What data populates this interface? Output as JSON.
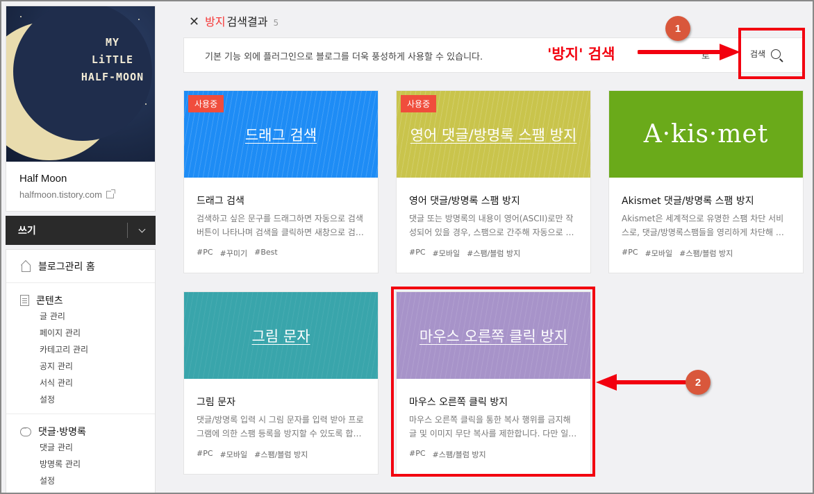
{
  "blog": {
    "cover_lines": [
      "MY",
      "LiTTLE",
      "HALF-MOON"
    ],
    "name": "Half Moon",
    "url": "halfmoon.tistory.com"
  },
  "write": {
    "label": "쓰기"
  },
  "menu": {
    "home": "블로그관리 홈",
    "sections": [
      {
        "title": "콘텐츠",
        "icon": "document-icon",
        "items": [
          "글 관리",
          "페이지 관리",
          "카테고리 관리",
          "공지 관리",
          "서식 관리",
          "설정"
        ]
      },
      {
        "title": "댓글·방명록",
        "icon": "speech-bubble-icon",
        "items": [
          "댓글 관리",
          "방명록 관리",
          "설정"
        ]
      }
    ]
  },
  "result": {
    "keyword": "방지",
    "label": "검색결과",
    "count": "5"
  },
  "search": {
    "description": "기본 기능 외에 플러그인으로 블로그를 더욱 풍성하게 사용할 수 있습니다.",
    "sort_label": "로",
    "button_label": "검색"
  },
  "plugins": [
    {
      "badge": "사용중",
      "thumb_title": "드래그 검색",
      "name": "드래그 검색",
      "desc": "검색하고 싶은 문구를 드래그하면 자동으로 검색 버튼이 나타나며 검색을 클릭하면 새창으로 검색 결과를 보여줍니다.",
      "tags": [
        "#PC",
        "#꾸미기",
        "#Best"
      ],
      "color": "#1e8cf5"
    },
    {
      "badge": "사용중",
      "thumb_title": "영어 댓글/방명록 스팸 방지",
      "name": "영어 댓글/방명록 스팸 방지",
      "desc": "댓글 또는 방명록의 내용이 영어(ASCII)로만 작성되어 있을 경우, 스팸으로 간주해 자동으로 차단합니다.",
      "tags": [
        "#PC",
        "#모바일",
        "#스팸/블럼 방지"
      ],
      "color": "#c9c44c"
    },
    {
      "badge": "",
      "thumb_title": "A·kis·met",
      "name": "Akismet 댓글/방명록 스팸 방지",
      "desc": "Akismet은 세계적으로 유명한 스팸 차단 서비스로, 댓글/방명록스팸들을 영리하게 차단해 줍니다.",
      "tags": [
        "#PC",
        "#모바일",
        "#스팸/블럼 방지"
      ],
      "color": "#6aaa1a"
    },
    {
      "badge": "",
      "thumb_title": "그림 문자",
      "name": "그림 문자",
      "desc": "댓글/방명록 입력 시 그림 문자를 입력 받아 프로그램에 의한 스팸 등록을 방지할 수 있도록 합니다.",
      "tags": [
        "#PC",
        "#모바일",
        "#스팸/블럼 방지"
      ],
      "color": "#39a5ab"
    },
    {
      "badge": "",
      "thumb_title": "마우스 오른쪽 클릭 방지",
      "name": "마우스 오른쪽 클릭 방지",
      "desc": "마우스 오른쪽 클릭을 통한 복사 행위를 금지해 글 및 이미지 무단 복사를 제한합니다. 다만 일부 기능이 제한될 수 있습니다.",
      "tags": [
        "#PC",
        "#스팸/블럼 방지"
      ],
      "color": "#a793c9"
    }
  ],
  "annotations": {
    "step1": "1",
    "step2": "2",
    "callout": "'방지' 검색",
    "color": "#f2000f"
  }
}
